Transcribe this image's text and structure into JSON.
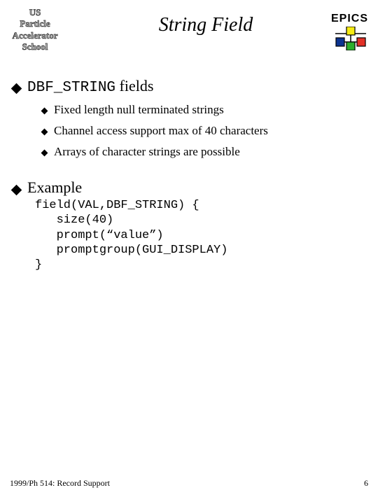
{
  "header": {
    "school_line1": "US",
    "school_line2": "Particle",
    "school_line3": "Accelerator",
    "school_line4": "School",
    "title": "String Field",
    "epics_label": "EPICS"
  },
  "bullets": {
    "l1a_prefix": "DBF_STRING",
    "l1a_suffix": " fields",
    "l2a": "Fixed length null terminated strings",
    "l2b": "Channel access support max of 40 characters",
    "l2c": "Arrays of character strings are possible",
    "l1b": "Example"
  },
  "code": "field(VAL,DBF_STRING) {\n   size(40)\n   prompt(“value”)\n   promptgroup(GUI_DISPLAY)\n}",
  "footer": {
    "left": "1999/Ph 514: Record Support",
    "right": "6"
  },
  "colors": {
    "yellow": "#f6eb13",
    "blue": "#0b3390",
    "green": "#2bae2b",
    "red": "#e23127"
  }
}
